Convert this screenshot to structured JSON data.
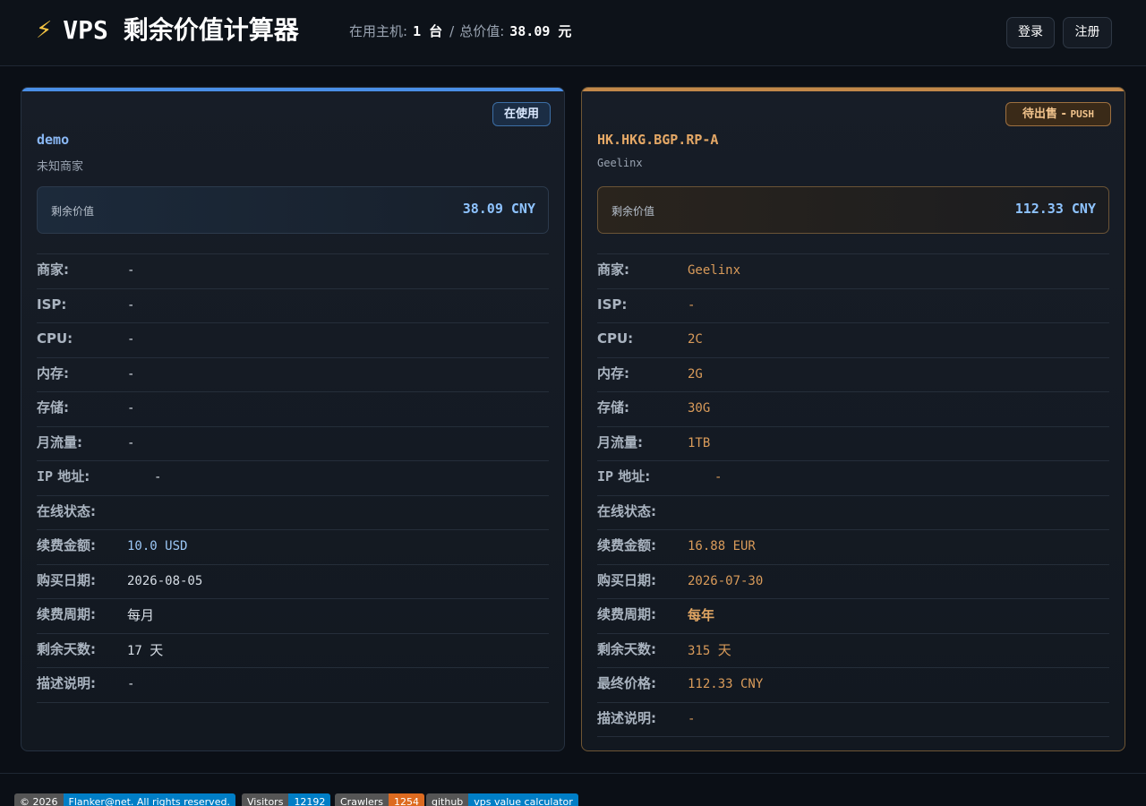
{
  "header": {
    "icon": "lightning-icon",
    "title_latin": "VPS",
    "title_cjk": "剩余价值计算器",
    "hosts_label": "在用主机:",
    "hosts_count": "1 台",
    "separator": "/",
    "total_label": "总价值:",
    "total_value": "38.09 元",
    "login_label": "登录",
    "register_label": "注册"
  },
  "cards": [
    {
      "badge": "在使用",
      "name": "demo",
      "merchant_sub": "未知商家",
      "value_label": "剩余价值",
      "value_amount": "38.09 CNY",
      "rows": [
        {
          "label": "商家:",
          "value": "-"
        },
        {
          "label": "ISP:",
          "value": "-"
        },
        {
          "label": "CPU:",
          "value": "-"
        },
        {
          "label": "内存:",
          "value": "-"
        },
        {
          "label": "存储:",
          "value": "-"
        },
        {
          "label": "月流量:",
          "value": "-"
        },
        {
          "label_latin": "IP",
          "label": "地址:",
          "value": "-"
        },
        {
          "label": "在线状态:",
          "value": ""
        },
        {
          "label": "续费金额:",
          "value": "10.0 USD"
        },
        {
          "label": "购买日期:",
          "value": "2026-08-05"
        },
        {
          "label": "续费周期:",
          "value": "每月"
        },
        {
          "label": "剩余天数:",
          "value": "17",
          "unit": "天"
        },
        {
          "label": "描述说明:",
          "value": "-"
        }
      ]
    },
    {
      "badge": "待出售 -",
      "badge_tag": "PUSH",
      "name": "HK.HKG.BGP.RP-A",
      "merchant_sub": "Geelinx",
      "value_label": "剩余价值",
      "value_amount": "112.33 CNY",
      "rows": [
        {
          "label": "商家:",
          "value": "Geelinx"
        },
        {
          "label": "ISP:",
          "value": "-"
        },
        {
          "label": "CPU:",
          "value": "2C"
        },
        {
          "label": "内存:",
          "value": "2G"
        },
        {
          "label": "存储:",
          "value": "30G"
        },
        {
          "label": "月流量:",
          "value": "1TB"
        },
        {
          "label_latin": "IP",
          "label": "地址:",
          "value": "-"
        },
        {
          "label": "在线状态:",
          "value": ""
        },
        {
          "label": "续费金额:",
          "value": "16.88 EUR"
        },
        {
          "label": "购买日期:",
          "value": "2026-07-30"
        },
        {
          "label": "续费周期:",
          "value": "每年"
        },
        {
          "label": "剩余天数:",
          "value": "315",
          "unit": "天"
        },
        {
          "label": "最终价格:",
          "value": "112.33 CNY"
        },
        {
          "label": "描述说明:",
          "value": "-"
        }
      ]
    }
  ],
  "footer": {
    "copyright_l": "© 2026",
    "copyright_r": "Flanker@net. All rights reserved.",
    "visitors_l": "Visitors",
    "visitors_r": "12192",
    "crawlers_l": "Crawlers",
    "crawlers_r": "1254",
    "github_l": "github",
    "github_r": "vps value calculator"
  },
  "colors": {
    "accent_blue": "#4a8fe7",
    "accent_orange": "#c2884a",
    "badge_blue": "#007ec6",
    "badge_orange": "#dd6b20"
  }
}
